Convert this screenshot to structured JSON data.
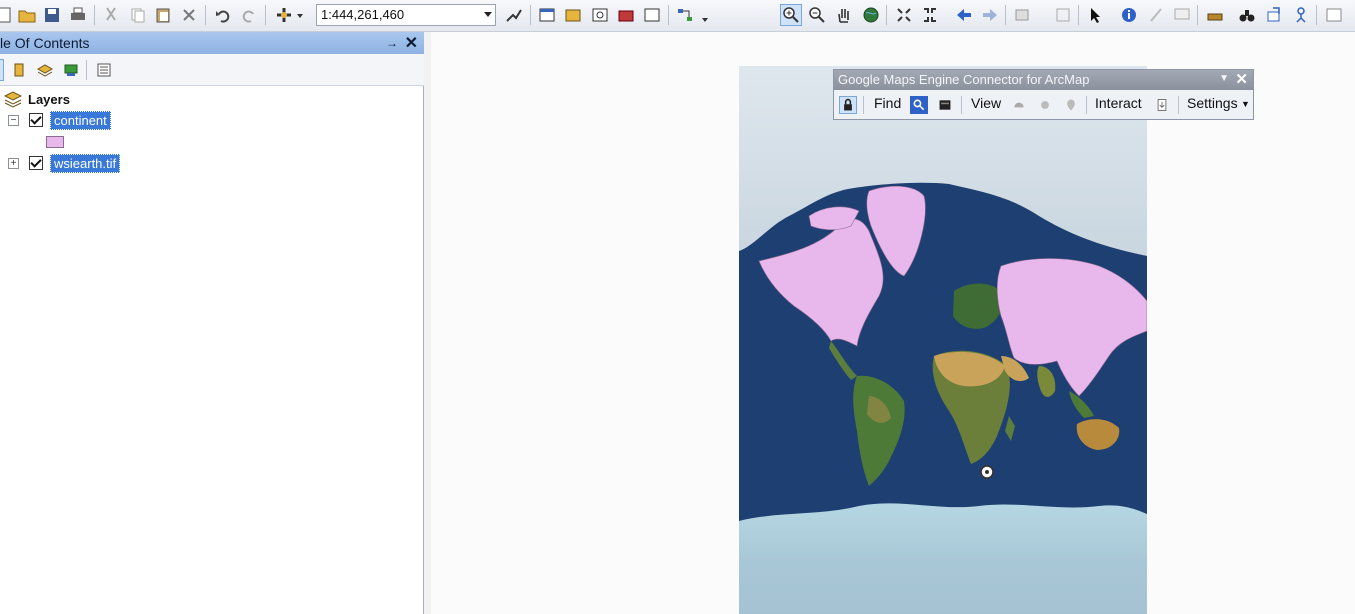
{
  "toolbar": {
    "scale_value": "1:444,261,460"
  },
  "toc": {
    "title": "le Of Contents",
    "pin_glyph": "→",
    "close_glyph": "✕",
    "root_label": "Layers",
    "layers": [
      {
        "name": "continent",
        "expanded": true,
        "checked": true,
        "swatch_color": "#e8b7ec"
      },
      {
        "name": "wsiearth.tif",
        "expanded": false,
        "checked": true
      }
    ]
  },
  "gme": {
    "title": "Google Maps Engine Connector for ArcMap",
    "find_label": "Find",
    "view_label": "View",
    "interact_label": "Interact",
    "settings_label": "Settings"
  },
  "colors": {
    "continent_fill": "#e8b7ec",
    "ocean": "#1e3f72",
    "selection": "#3878d8",
    "toc_header": "#8eb2e3"
  }
}
